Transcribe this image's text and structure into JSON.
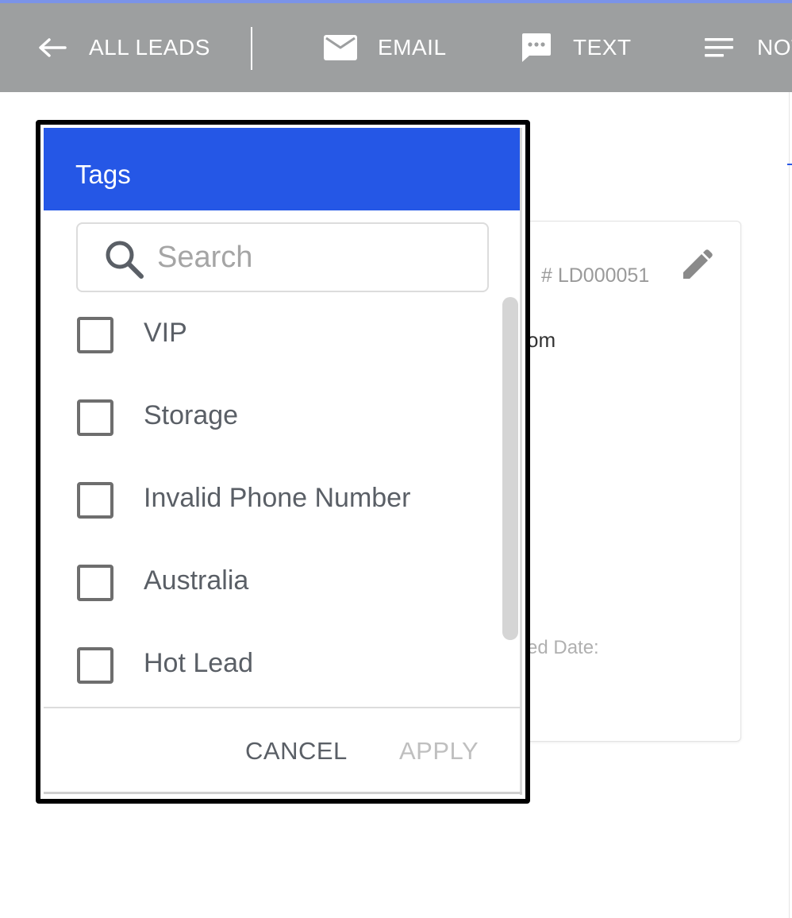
{
  "toolbar": {
    "back_label": "ALL LEADS",
    "email_label": "EMAIL",
    "sms_label": "TEXT",
    "notes_label": "NOT",
    "background_color": "#9d9fa0",
    "accent_color": "#7b93e8"
  },
  "lead_card": {
    "id_text": "# LD000051",
    "email_fragment": "om",
    "date_label_fragment": "ed Date:"
  },
  "tags_dialog": {
    "title": "Tags",
    "header_color": "#2557e6",
    "search": {
      "placeholder": "Search",
      "value": ""
    },
    "tags": [
      {
        "label": "VIP",
        "checked": false
      },
      {
        "label": "Storage",
        "checked": false
      },
      {
        "label": "Invalid Phone Number",
        "checked": false
      },
      {
        "label": "Australia",
        "checked": false
      },
      {
        "label": "Hot Lead",
        "checked": false
      }
    ],
    "cancel_label": "CANCEL",
    "apply_label": "APPLY",
    "apply_disabled": true
  },
  "icons": {
    "back": "arrow-left-icon",
    "email": "envelope-icon",
    "sms": "chat-bubble-icon",
    "notes": "notes-lines-icon",
    "edit": "pencil-icon",
    "search": "magnifier-icon"
  }
}
